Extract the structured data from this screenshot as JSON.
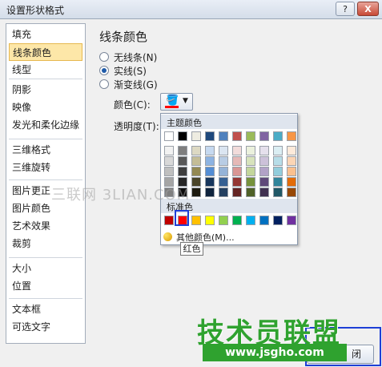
{
  "window": {
    "title": "设置形状格式",
    "help_label": "?",
    "close_label": "X"
  },
  "sidebar": {
    "items": [
      {
        "label": "填充",
        "selected": false
      },
      {
        "label": "线条颜色",
        "selected": true
      },
      {
        "label": "线型",
        "selected": false
      },
      {
        "label": "阴影",
        "selected": false
      },
      {
        "label": "映像",
        "selected": false
      },
      {
        "label": "发光和柔化边缘",
        "selected": false
      },
      {
        "label": "三维格式",
        "selected": false
      },
      {
        "label": "三维旋转",
        "selected": false
      },
      {
        "label": "图片更正",
        "selected": false
      },
      {
        "label": "图片颜色",
        "selected": false
      },
      {
        "label": "艺术效果",
        "selected": false
      },
      {
        "label": "裁剪",
        "selected": false
      },
      {
        "label": "大小",
        "selected": false
      },
      {
        "label": "位置",
        "selected": false
      },
      {
        "label": "文本框",
        "selected": false
      },
      {
        "label": "可选文字",
        "selected": false
      }
    ]
  },
  "panel": {
    "heading": "线条颜色",
    "options": [
      {
        "label": "无线条(N)",
        "checked": false
      },
      {
        "label": "实线(S)",
        "checked": true
      },
      {
        "label": "渐变线(G)",
        "checked": false
      }
    ],
    "color_label": "颜色(C):",
    "transparency_label": "透明度(T):",
    "color_button": {
      "icon": "paint-bucket-icon",
      "current_color": "#ff0000"
    }
  },
  "dropdown": {
    "theme_header": "主题颜色",
    "standard_header": "标准色",
    "theme_top_row": [
      "#ffffff",
      "#000000",
      "#eeece1",
      "#1f497d",
      "#4f81bd",
      "#c0504d",
      "#9bbb59",
      "#8064a2",
      "#4bacc6",
      "#f79646"
    ],
    "theme_shades": [
      [
        "#f2f2f2",
        "#7f7f7f",
        "#ddd9c3",
        "#c6d9f0",
        "#dbe5f1",
        "#f2dcdb",
        "#ebf1dd",
        "#e5e0ec",
        "#dbeef3",
        "#fdeada"
      ],
      [
        "#d8d8d8",
        "#595959",
        "#c4bd97",
        "#8db3e2",
        "#b8cce4",
        "#e5b9b7",
        "#d7e3bc",
        "#ccc1d9",
        "#b7dde8",
        "#fbd5b5"
      ],
      [
        "#bfbfbf",
        "#3f3f3f",
        "#938953",
        "#548dd4",
        "#95b3d7",
        "#d99694",
        "#c3d69b",
        "#b2a2c7",
        "#92cddc",
        "#fac08f"
      ],
      [
        "#a5a5a5",
        "#262626",
        "#494429",
        "#17365d",
        "#366092",
        "#953734",
        "#76923c",
        "#5f497a",
        "#31859b",
        "#e36c09"
      ],
      [
        "#7f7f7f",
        "#0c0c0c",
        "#1d1b10",
        "#0f243e",
        "#244061",
        "#632423",
        "#4f6128",
        "#3f3151",
        "#205867",
        "#974806"
      ]
    ],
    "standard_colors": [
      "#c00000",
      "#ff0000",
      "#ffc000",
      "#ffff00",
      "#92d050",
      "#00b050",
      "#00b0f0",
      "#0070c0",
      "#002060",
      "#7030a0"
    ],
    "selected_standard_index": 1,
    "more_colors_label": "其他颜色(M)...",
    "tooltip": "红色"
  },
  "watermark": "三联网 3LIAN.COM",
  "brand": {
    "name": "技术员联盟",
    "url": "www.jsgho.com"
  },
  "buttons": {
    "close_label": "闭"
  }
}
